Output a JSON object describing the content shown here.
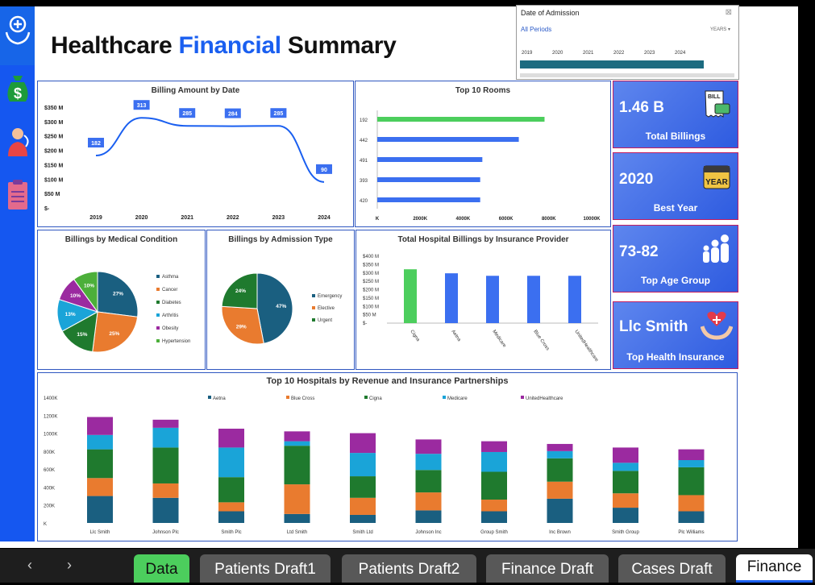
{
  "header": {
    "title_part1": "Healthcare ",
    "title_part2": "Financial",
    "title_part3": " Summary"
  },
  "sidebar": {
    "icons": [
      "hands-heart-icon",
      "money-bag-icon",
      "doctor-icon",
      "clipboard-icon"
    ]
  },
  "slicer": {
    "title": "Date of Admission",
    "all_periods": "All Periods",
    "unit": "YEARS",
    "years": [
      "2019",
      "2020",
      "2021",
      "2022",
      "2023",
      "2024"
    ]
  },
  "kpis": [
    {
      "value": "1.46 B",
      "label": "Total Billings",
      "icon": "bill-icon"
    },
    {
      "value": "2020",
      "label": "Best Year",
      "icon": "calendar-year-icon"
    },
    {
      "value": "73-82",
      "label": "Top Age Group",
      "icon": "family-icon"
    },
    {
      "value": "Llc Smith",
      "label": "Top Health Insurance",
      "icon": "insurance-hand-heart-icon"
    }
  ],
  "tabs": {
    "items": [
      "Data",
      "Patients Draft1",
      "Patients Draft2",
      "Finance Draft",
      "Cases Draft",
      "Finance"
    ],
    "active": "Finance"
  },
  "colors": {
    "accent": "#1a5ff0",
    "aetna": "#1a5f80",
    "bluecross": "#e97b2f",
    "cigna": "#1f7a2e",
    "medicare": "#1aa4d8",
    "united": "#9b2aa0",
    "green": "#4cce5d",
    "bar": "#3b6ff0"
  },
  "chart_data": [
    {
      "type": "line",
      "title": "Billing Amount by Date",
      "x": [
        "2019",
        "2020",
        "2021",
        "2022",
        "2023",
        "2024"
      ],
      "values": [
        182,
        313,
        285,
        284,
        285,
        90
      ],
      "data_labels": [
        "182",
        "313",
        "285",
        "284",
        "285",
        "90"
      ],
      "y_ticks": [
        "$350 M",
        "$300 M",
        "$250 M",
        "$200 M",
        "$150 M",
        "$100 M",
        "$50 M",
        "$-"
      ],
      "ylim": [
        0,
        350
      ]
    },
    {
      "type": "bar",
      "orientation": "horizontal",
      "title": "Top 10 Rooms",
      "categories": [
        "192",
        "442",
        "491",
        "393",
        "420"
      ],
      "values": [
        7800,
        6600,
        4900,
        4800,
        4800
      ],
      "x_ticks": [
        "K",
        "2000K",
        "4000K",
        "6000K",
        "8000K",
        "10000K"
      ],
      "xlim": [
        0,
        10000
      ]
    },
    {
      "type": "pie",
      "title": "Billings by Medical Condition",
      "categories": [
        "Asthma",
        "Cancer",
        "Diabetes",
        "Arthritis",
        "Obesity",
        "Hypertension"
      ],
      "values": [
        27,
        25,
        15,
        13,
        10,
        10
      ],
      "labels": [
        "27%",
        "25%",
        "15%",
        "13%",
        "10%",
        "10%"
      ]
    },
    {
      "type": "pie",
      "title": "Billings by Admission Type",
      "categories": [
        "Emergency",
        "Elective",
        "Urgent"
      ],
      "values": [
        47,
        29,
        24
      ],
      "labels": [
        "47%",
        "29%",
        "24%"
      ]
    },
    {
      "type": "bar",
      "title": "Total Hospital Billings by Insurance Provider",
      "categories": [
        "Cigna",
        "Aetna",
        "Medicare",
        "Blue Cross",
        "UnitedHealthcare"
      ],
      "values": [
        322,
        298,
        283,
        283,
        283
      ],
      "y_ticks": [
        "$400 M",
        "$350 M",
        "$300 M",
        "$250 M",
        "$200 M",
        "$150 M",
        "$100 M",
        "$50 M",
        "$-"
      ],
      "ylim": [
        0,
        400
      ]
    },
    {
      "type": "bar",
      "stacked": true,
      "title": "Top 10 Hospitals by Revenue and Insurance Partnerships",
      "categories": [
        "Llc Smith",
        "Johnson Plc",
        "Smith Plc",
        "Ltd Smith",
        "Smith Ltd",
        "Johnson Inc",
        "Group Smith",
        "Inc Brown",
        "Smith Group",
        "Plc Williams"
      ],
      "y_ticks": [
        "1400K",
        "1200K",
        "1000K",
        "800K",
        "600K",
        "400K",
        "200K",
        "K"
      ],
      "ylim": [
        0,
        1400
      ],
      "series": [
        {
          "name": "Aetna",
          "values": [
            300,
            280,
            130,
            100,
            90,
            140,
            130,
            270,
            170,
            130
          ]
        },
        {
          "name": "Blue Cross",
          "values": [
            200,
            160,
            100,
            330,
            190,
            200,
            130,
            190,
            160,
            180
          ]
        },
        {
          "name": "Cigna",
          "values": [
            320,
            400,
            280,
            430,
            240,
            250,
            310,
            260,
            250,
            310
          ]
        },
        {
          "name": "Medicare",
          "values": [
            160,
            220,
            330,
            50,
            260,
            180,
            220,
            80,
            90,
            80
          ]
        },
        {
          "name": "UnitedHealthcare",
          "values": [
            200,
            90,
            210,
            110,
            220,
            160,
            120,
            80,
            170,
            120
          ]
        }
      ]
    }
  ]
}
